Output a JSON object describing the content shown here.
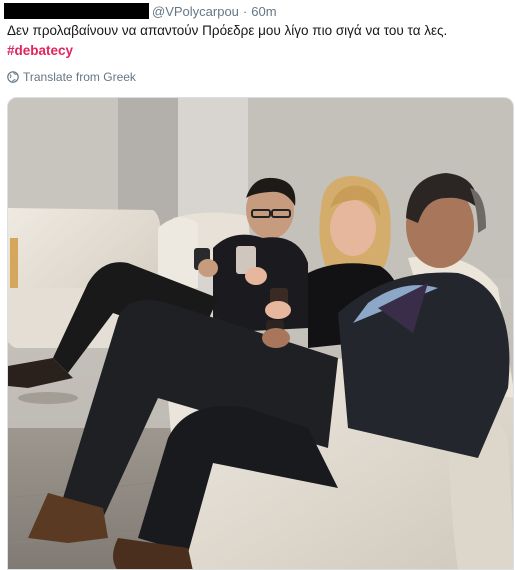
{
  "tweet": {
    "handle": "@VPolycarpou",
    "separator": "·",
    "time": "60m",
    "text": "Δεν προλαβαίνουν να απαντούν Πρόεδρε μου λίγο πιο σιγά να του τα λες.",
    "hashtag": "#debatecy",
    "translate_label": "Translate from Greek"
  },
  "icons": {
    "translate": "globe-icon"
  },
  "colors": {
    "hashtag": "#e0245e",
    "meta_text": "#657786",
    "body_text": "#14171a"
  }
}
